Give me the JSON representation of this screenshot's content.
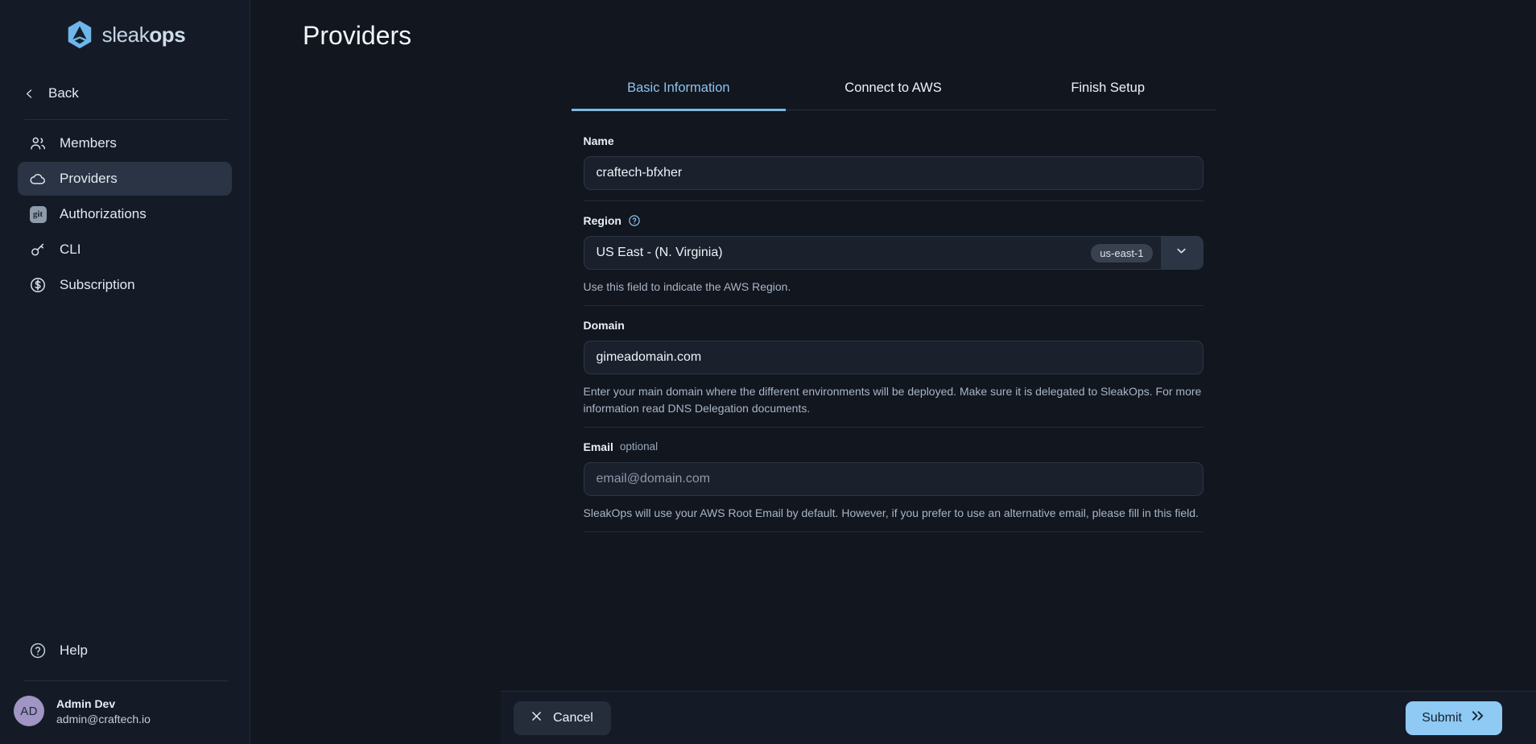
{
  "brand": {
    "name_light": "sleak",
    "name_bold": "ops",
    "logo_icon": "sleakops-hexagon-logo"
  },
  "sidebar": {
    "back_label": "Back",
    "items": [
      {
        "label": "Members",
        "icon": "users-icon"
      },
      {
        "label": "Providers",
        "icon": "cloud-icon",
        "active": true
      },
      {
        "label": "Authorizations",
        "icon": "git-icon"
      },
      {
        "label": "CLI",
        "icon": "key-icon"
      },
      {
        "label": "Subscription",
        "icon": "dollar-circle-icon"
      }
    ],
    "help_label": "Help",
    "profile": {
      "initials": "AD",
      "name": "Admin Dev",
      "email": "admin@craftech.io"
    }
  },
  "header": {
    "title": "Providers"
  },
  "tabs": [
    {
      "label": "Basic Information",
      "active": true
    },
    {
      "label": "Connect to AWS",
      "active": false
    },
    {
      "label": "Finish Setup",
      "active": false
    }
  ],
  "form": {
    "name": {
      "label": "Name",
      "value": "craftech-bfxher"
    },
    "region": {
      "label": "Region",
      "value": "US East - (N. Virginia)",
      "badge": "us-east-1",
      "hint": "Use this field to indicate the AWS Region."
    },
    "domain": {
      "label": "Domain",
      "value": "gimeadomain.com",
      "hint": "Enter your main domain where the different environments will be deployed. Make sure it is delegated to SleakOps. For more information read DNS Delegation documents."
    },
    "email": {
      "label": "Email",
      "optional": "optional",
      "placeholder": "email@domain.com",
      "hint": "SleakOps will use your AWS Root Email by default. However, if you prefer to use an alternative email, please fill in this field."
    }
  },
  "footer": {
    "cancel_label": "Cancel",
    "submit_label": "Submit"
  },
  "colors": {
    "accent": "#8ecaf4",
    "sidebar_bg": "#151b26",
    "page_bg": "#11161f",
    "avatar_bg": "#a095c4"
  }
}
